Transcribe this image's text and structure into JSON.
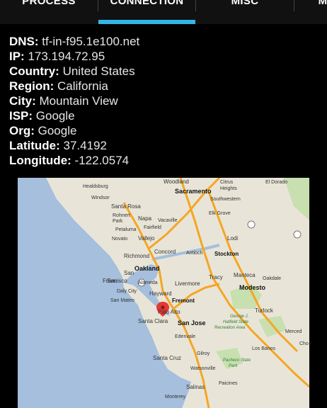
{
  "tabs": [
    {
      "label": "PROCESS",
      "active": false
    },
    {
      "label": "CONNECTION",
      "active": true
    },
    {
      "label": "MISC",
      "active": false
    },
    {
      "label": "M",
      "active": false
    }
  ],
  "info": [
    {
      "key": "DNS:",
      "value": "tf-in-f95.1e100.net"
    },
    {
      "key": "IP:",
      "value": "173.194.72.95"
    },
    {
      "key": "Country:",
      "value": "United States"
    },
    {
      "key": "Region:",
      "value": "California"
    },
    {
      "key": "City:",
      "value": "Mountain View"
    },
    {
      "key": "ISP:",
      "value": "Google"
    },
    {
      "key": "Org:",
      "value": "Google"
    },
    {
      "key": "Latitude:",
      "value": "37.4192"
    },
    {
      "key": "Longitude:",
      "value": "-122.0574"
    }
  ],
  "map": {
    "places": {
      "healdsburg": "Healdsburg",
      "woodland": "Woodland",
      "citrus_heights": "Citrus",
      "heights": "Heights",
      "el_dorado": "El Dorado",
      "windsor": "Windsor",
      "sacramento": "Sacramento",
      "santa_rosa": "Santa Rosa",
      "southwestern": "Southwestern",
      "rohnert_park_1": "Rohnert",
      "rohnert_park_2": "Park",
      "napa": "Napa",
      "vacaville": "Vacaville",
      "elk_grove": "Elk Grove",
      "petaluma": "Petaluma",
      "fairfield": "Fairfield",
      "novato": "Novato",
      "vallejo": "Vallejo",
      "lodi": "Lodi",
      "richmond": "Richmond",
      "concord": "Concord",
      "antioch": "Antioch",
      "stockton": "Stockton",
      "san_rafael": "San",
      "oakland": "Oakland",
      "san_francisco": "San",
      "francisco": "Francisco",
      "alameda": "Alameda",
      "livermore": "Livermore",
      "tracy": "Tracy",
      "manteca": "Manteca",
      "daly_city": "Daly City",
      "hayward": "Hayward",
      "modesto": "Modesto",
      "oakdale": "Oakdale",
      "san_mateo": "San Mateo",
      "fremont": "Fremont",
      "palo_alto": "Palo Alto",
      "turlock": "Turlock",
      "san_jose": "San Jose",
      "santa_clara": "Santa Clara",
      "george_j": "George J.",
      "hatfield_state": "Hatfield State",
      "recreation_area": "Recreation Area",
      "merced": "Merced",
      "edenvale": "Edenvale",
      "los_banos": "Los Banos",
      "gilroy": "Gilroy",
      "chow": "Cho",
      "santa_cruz": "Santa Cruz",
      "pacheco_state": "Pacheco State",
      "park": "Park",
      "watsonville": "Watsonville",
      "paicines": "Paicines",
      "salinas": "Salinas",
      "monterey": "Monterey"
    },
    "shields": [
      "5",
      "80",
      "99",
      "49",
      "4",
      "101",
      "580",
      "5",
      "152",
      "101",
      "99"
    ],
    "colors": {
      "water": "#a5bfdd",
      "land": "#e8e5d8",
      "park": "#c8dfb0",
      "highway": "#f5a623",
      "marker": "#e53935"
    }
  }
}
